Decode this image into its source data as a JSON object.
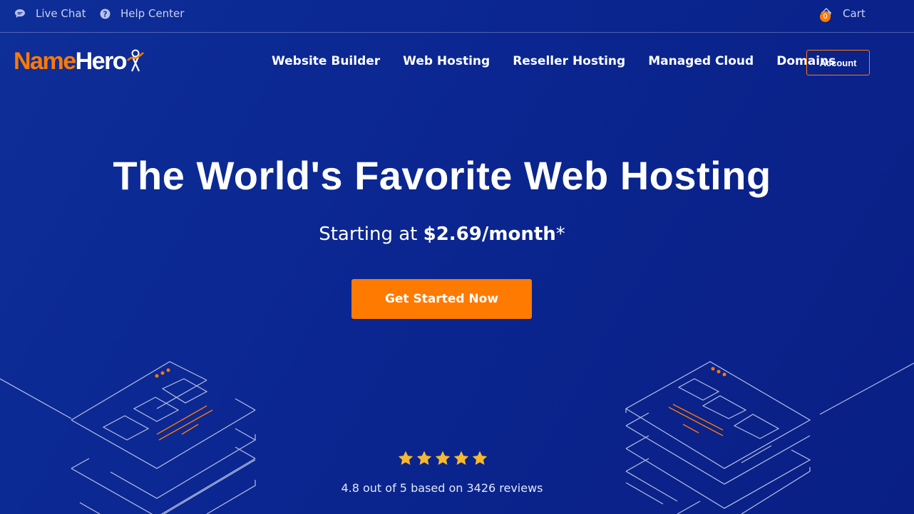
{
  "topbar": {
    "live_chat": "Live Chat",
    "help_center": "Help Center",
    "cart_label": "Cart",
    "cart_count": "0"
  },
  "logo": {
    "name": "Name",
    "hero": "Hero"
  },
  "nav": {
    "items": [
      {
        "label": "Website Builder"
      },
      {
        "label": "Web Hosting"
      },
      {
        "label": "Reseller Hosting"
      },
      {
        "label": "Managed Cloud"
      },
      {
        "label": "Domains"
      }
    ],
    "account_label": "Account"
  },
  "hero": {
    "title": "The World's Favorite Web Hosting",
    "subtitle_prefix": "Starting at ",
    "price": "$2.69/month",
    "subtitle_suffix": "*",
    "cta_label": "Get Started Now"
  },
  "reviews": {
    "stars": 5,
    "text": "4.8 out of 5 based on 3426 reviews"
  },
  "colors": {
    "background": "#0b2690",
    "accent": "#ff7a00",
    "star": "#f5b82e"
  },
  "icons": [
    "chat-icon",
    "help-icon",
    "cart-icon",
    "star-icon"
  ]
}
